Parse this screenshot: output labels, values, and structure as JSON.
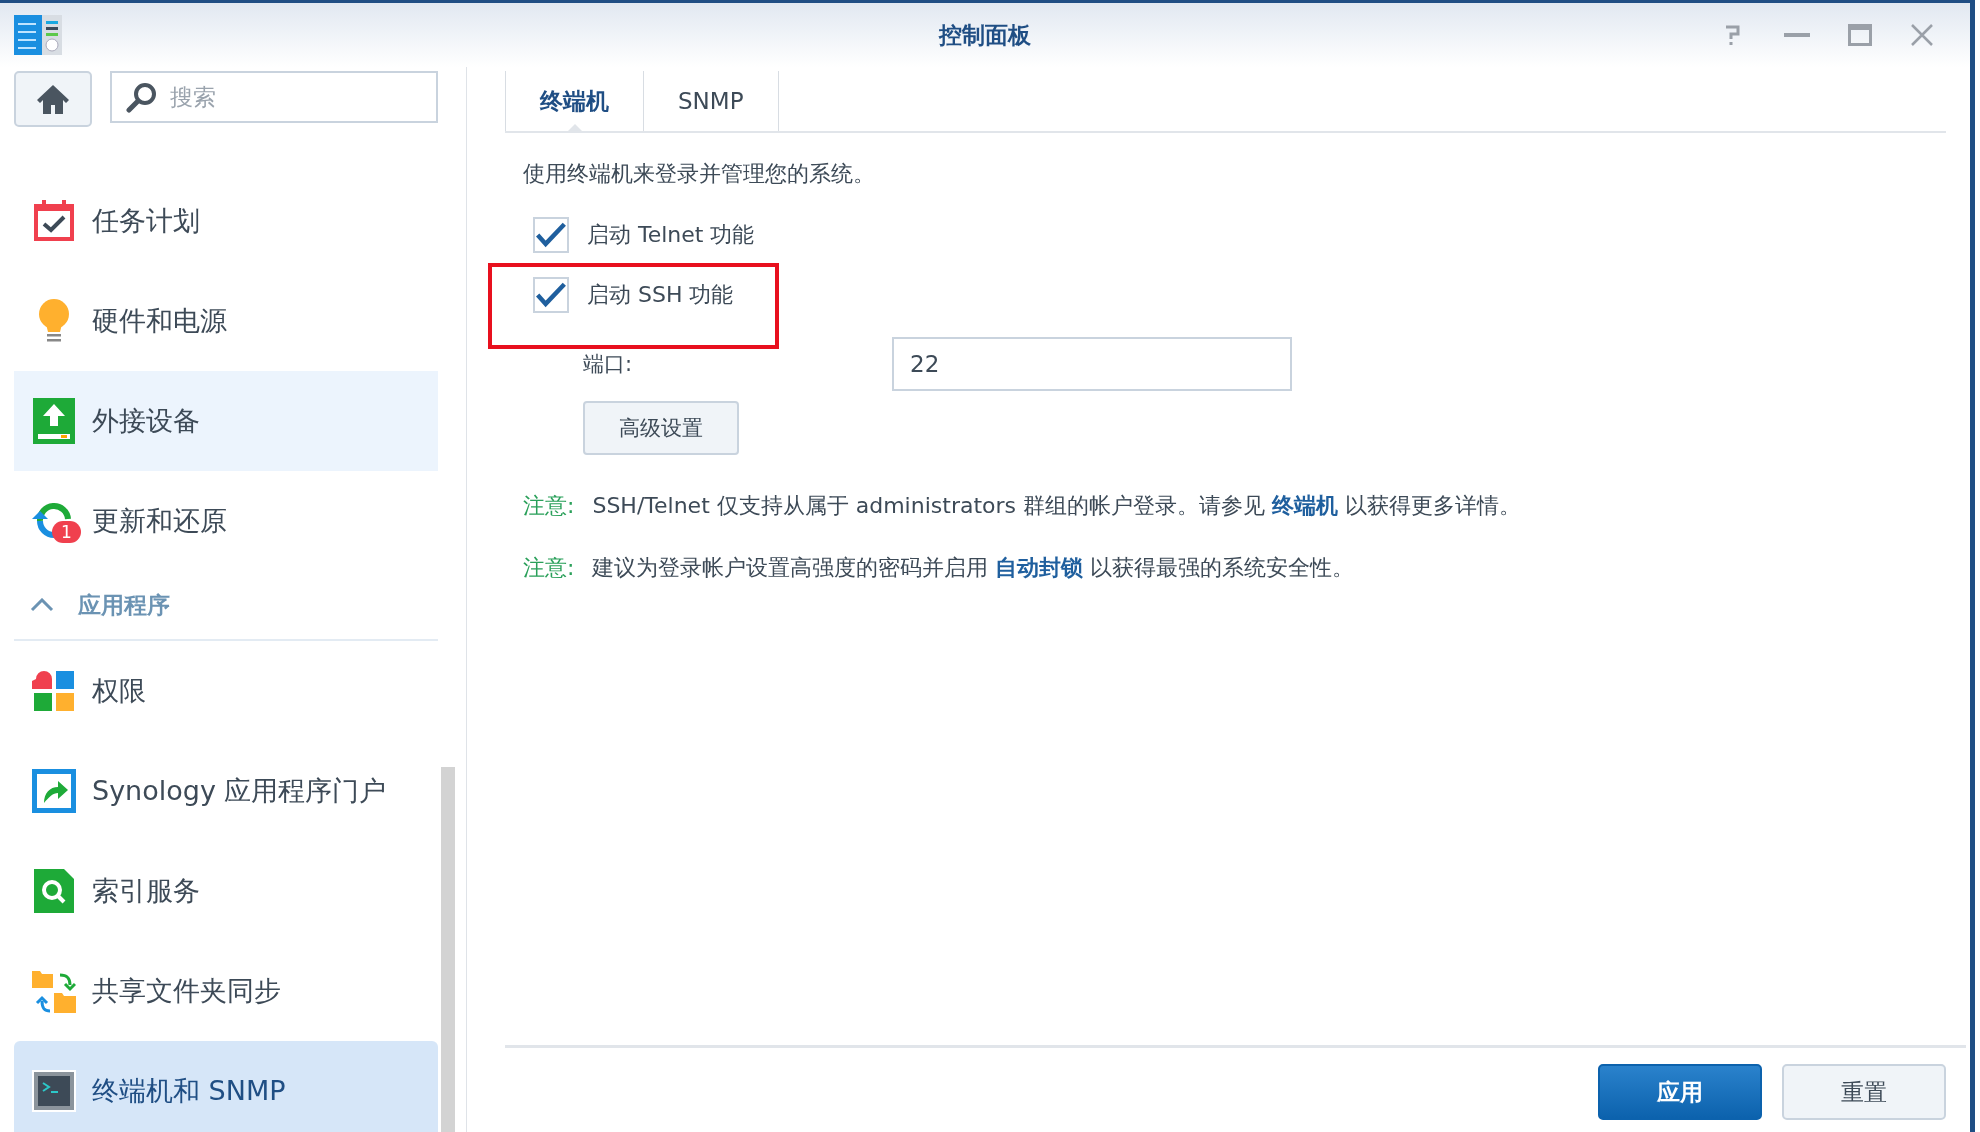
{
  "window": {
    "title": "控制面板"
  },
  "sidebar": {
    "search": {
      "placeholder": "搜索"
    },
    "entries": [
      {
        "kind": "item",
        "label": "任务计划",
        "hovered": false,
        "selected": false
      },
      {
        "kind": "item",
        "label": "硬件和电源",
        "hovered": false,
        "selected": false
      },
      {
        "kind": "item",
        "label": "外接设备",
        "hovered": true,
        "selected": false
      },
      {
        "kind": "item",
        "label": "更新和还原",
        "hovered": false,
        "selected": false,
        "badge": "1"
      },
      {
        "kind": "section",
        "label": "应用程序",
        "expanded": true
      },
      {
        "kind": "item",
        "label": "权限",
        "hovered": false,
        "selected": false
      },
      {
        "kind": "item",
        "label": "Synology 应用程序门户",
        "hovered": false,
        "selected": false
      },
      {
        "kind": "item",
        "label": "索引服务",
        "hovered": false,
        "selected": false
      },
      {
        "kind": "item",
        "label": "共享文件夹同步",
        "hovered": false,
        "selected": false
      },
      {
        "kind": "item",
        "label": "终端机和 SNMP",
        "hovered": false,
        "selected": true
      }
    ]
  },
  "main": {
    "tabs": [
      {
        "label": "终端机",
        "selected": true
      },
      {
        "label": "SNMP",
        "selected": false
      }
    ],
    "description": "使用终端机来登录并管理您的系统。",
    "checkboxes": [
      {
        "label": "启动 Telnet 功能",
        "checked": true,
        "highlighted": false
      },
      {
        "label": "启动 SSH 功能",
        "checked": true,
        "highlighted": true
      }
    ],
    "port": {
      "label": "端口:",
      "value": "22"
    },
    "advanced_button": "高级设置",
    "notes": [
      {
        "label": "注意:",
        "before": "SSH/Telnet 仅支持从属于 administrators 群组的帐户登录。请参见",
        "link": "终端机",
        "after": "以获得更多详情。"
      },
      {
        "label": "注意:",
        "before": "建议为登录帐户设置高强度的密码并启用",
        "link": "自动封锁",
        "after": "以获得最强的系统安全性。"
      }
    ],
    "buttons": [
      {
        "label": "应用",
        "kind": "primary"
      },
      {
        "label": "重置",
        "kind": "default"
      }
    ]
  }
}
